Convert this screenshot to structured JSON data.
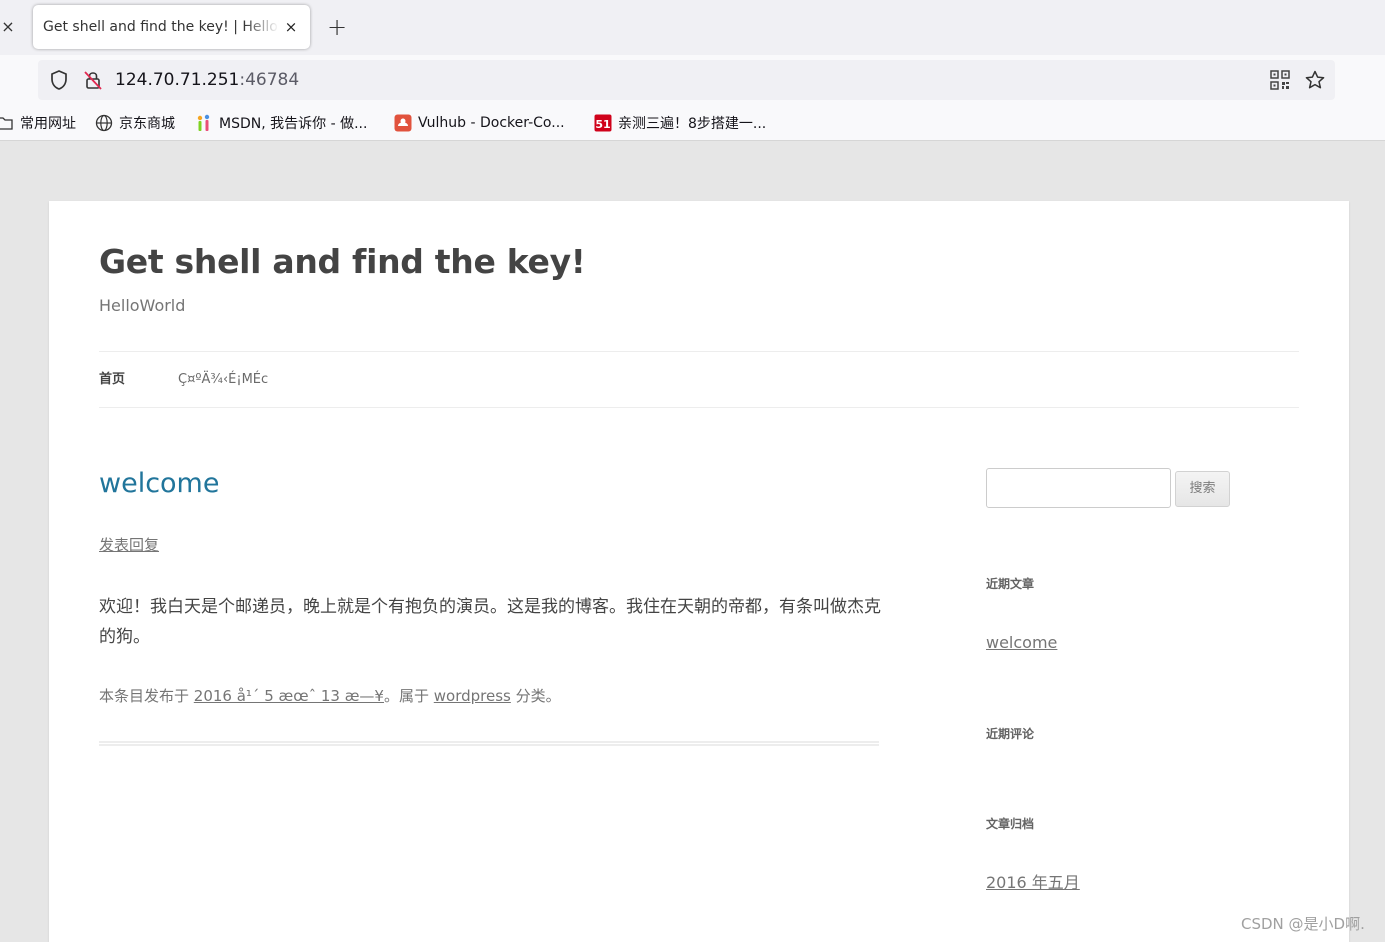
{
  "browser": {
    "tab": {
      "title": "Get shell and find the key! | HelloWorld",
      "close": "×",
      "new_tab": "+",
      "left_close": "×"
    },
    "url": {
      "host": "124.70.71.251",
      "port": ":46784"
    },
    "bookmarks": [
      {
        "label": "常用网址",
        "icon": "folder-icon"
      },
      {
        "label": "京东商城",
        "icon": "globe-icon"
      },
      {
        "label": "MSDN, 我告诉你 - 做...",
        "icon": "msdn-icon"
      },
      {
        "label": "Vulhub - Docker-Co...",
        "icon": "vulhub-icon"
      },
      {
        "label": "亲测三遍！8步搭建一...",
        "icon": "51cto-icon"
      }
    ]
  },
  "site": {
    "title": "Get shell and find the key!",
    "description": "HelloWorld",
    "menu": {
      "home": "首页",
      "page": "Ç¤ºÄ¾‹É¡MÉϲ"
    }
  },
  "post": {
    "title": "welcome",
    "reply": "发表回复",
    "content": "欢迎！我白天是个邮递员，晚上就是个有抱负的演员。这是我的博客。我住在天朝的帝都，有条叫做杰克的狗。",
    "meta": {
      "prefix": "本条目发布于 ",
      "date": "2016 å¹´ 5 æœˆ 13 æ—¥",
      "middle": "。属于 ",
      "category": "wordpress",
      "suffix": " 分类。"
    }
  },
  "sidebar": {
    "search_button": "搜索",
    "recent_posts_title": "近期文章",
    "recent_post": "welcome",
    "recent_comments_title": "近期评论",
    "archives_title": "文章归档",
    "archive_item": "2016 年五月"
  },
  "watermark": "CSDN @是小D啊."
}
